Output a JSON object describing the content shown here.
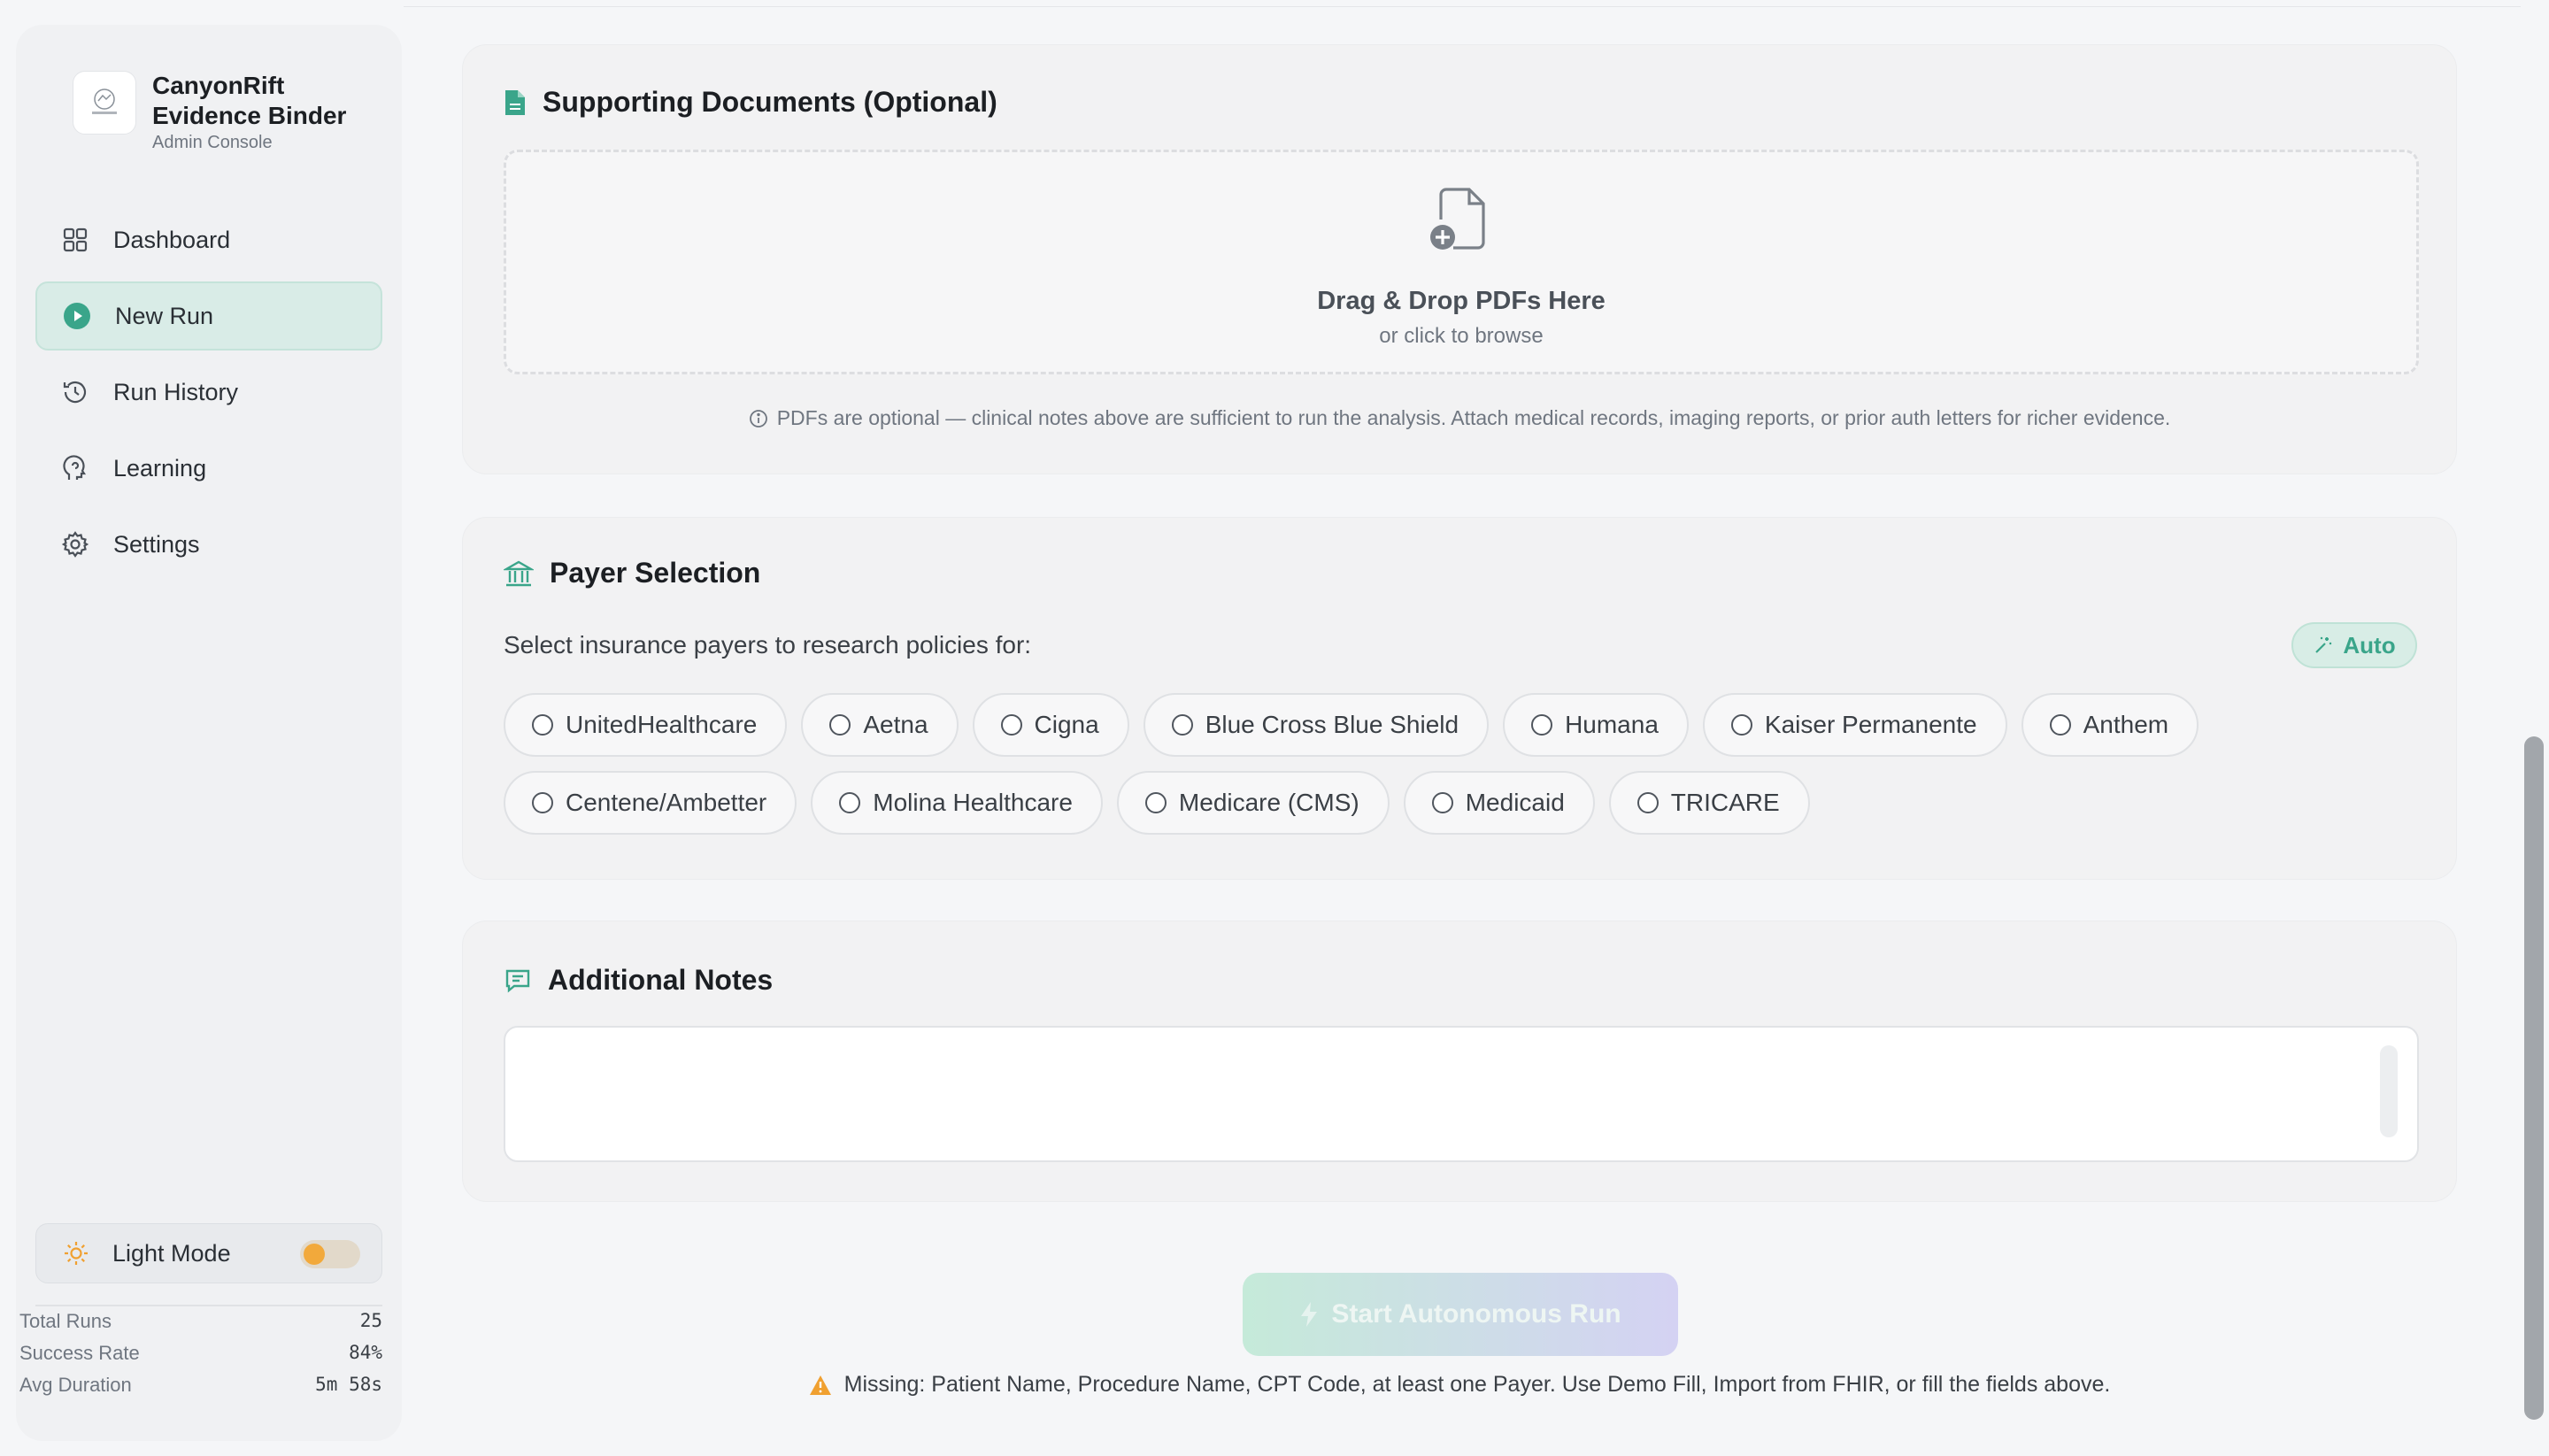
{
  "app": {
    "name": "CanyonRift Evidence Binder",
    "name_line1": "CanyonRift",
    "name_line2": "Evidence Binder",
    "subtitle": "Admin Console"
  },
  "sidebar": {
    "items": [
      {
        "label": "Dashboard",
        "icon": "grid-icon"
      },
      {
        "label": "New Run",
        "icon": "play-circle-icon",
        "active": true
      },
      {
        "label": "Run History",
        "icon": "history-icon"
      },
      {
        "label": "Learning",
        "icon": "brain-head-icon"
      },
      {
        "label": "Settings",
        "icon": "gear-icon"
      }
    ],
    "light_mode_label": "Light Mode",
    "stats": [
      {
        "label": "Total Runs",
        "value": "25"
      },
      {
        "label": "Success Rate",
        "value": "84%"
      },
      {
        "label": "Avg Duration",
        "value": "5m 58s"
      }
    ]
  },
  "supporting_docs": {
    "title": "Supporting Documents (Optional)",
    "drop_title": "Drag & Drop PDFs Here",
    "drop_sub": "or click to browse",
    "note": "PDFs are optional — clinical notes above are sufficient to run the analysis. Attach medical records, imaging reports, or prior auth letters for richer evidence."
  },
  "payer_selection": {
    "title": "Payer Selection",
    "prompt": "Select insurance payers to research policies for:",
    "auto_label": "Auto",
    "row1": [
      "UnitedHealthcare",
      "Aetna",
      "Cigna",
      "Blue Cross Blue Shield",
      "Humana",
      "Kaiser Permanente",
      "Anthem"
    ],
    "row2": [
      "Centene/Ambetter",
      "Molina Healthcare",
      "Medicare (CMS)",
      "Medicaid",
      "TRICARE"
    ]
  },
  "additional_notes": {
    "title": "Additional Notes",
    "value": ""
  },
  "actions": {
    "start_label": "Start Autonomous Run",
    "missing_text": "Missing: Patient Name, Procedure Name, CPT Code, at least one Payer. Use Demo Fill, Import from FHIR, or fill the fields above."
  },
  "colors": {
    "accent": "#3aa58a",
    "active_nav_bg": "#d9ece7",
    "warning": "#f0a030",
    "toggle_knob": "#f2a93b"
  }
}
